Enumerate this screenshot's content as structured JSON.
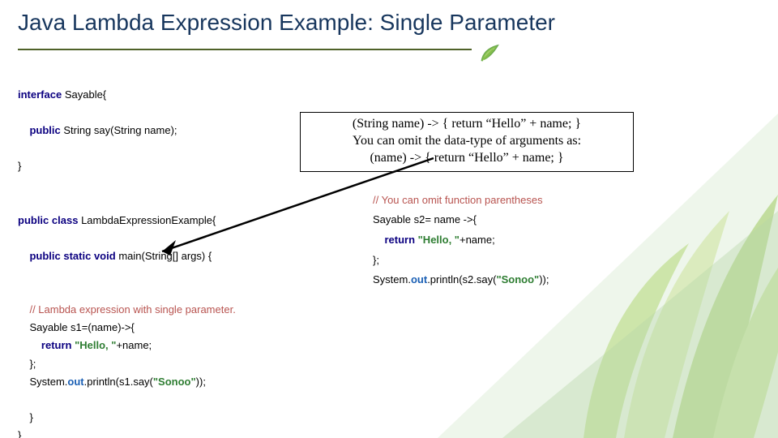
{
  "title": "Java Lambda Expression Example: Single Parameter",
  "code": {
    "line1_kw": "interface",
    "line1_rest": "Sayable{",
    "line2_kw": "public",
    "line2_rest": "String say(String name);",
    "line3": "}",
    "line4_kw1": "public",
    "line4_kw2": "class",
    "line4_rest": "LambdaExpressionExample{",
    "line5_kw1": "public",
    "line5_kw2": "static",
    "line5_kw3": "void",
    "line5_rest": "main(String[] args) {",
    "left_cmt": "// Lambda expression with single parameter.",
    "left_l1": "Sayable s1=(name)->{",
    "left_ret_kw": "return",
    "left_ret_str": "\"Hello, \"",
    "left_ret_rest": "+name;",
    "left_close": "};",
    "left_print_a": "System.",
    "left_print_b": "out",
    "left_print_c": ".println(s1.say(",
    "left_print_str": "\"Sonoo\"",
    "left_print_d": "));",
    "right_cmt": "// You can omit function parentheses",
    "right_l1": "Sayable s2= name ->{",
    "right_ret_kw": "return",
    "right_ret_str": "\"Hello, \"",
    "right_ret_rest": "+name;",
    "right_close": "};",
    "right_print_a": "System.",
    "right_print_b": "out",
    "right_print_c": ".println(s2.say(",
    "right_print_str": "\"Sonoo\"",
    "right_print_d": "));",
    "end_brace1": "}",
    "end_brace2": "}"
  },
  "callout": {
    "line1": "(String name) -> { return “Hello” + name; }",
    "line2": "You can omit the data-type of arguments as:",
    "line3": "(name) -> { return “Hello” + name; }"
  },
  "colors": {
    "title": "#17365d",
    "rule": "#4f6228",
    "keyword": "#0b0080",
    "comment": "#b85450",
    "string": "#2e7d32",
    "ref": "#1a5fb4"
  }
}
